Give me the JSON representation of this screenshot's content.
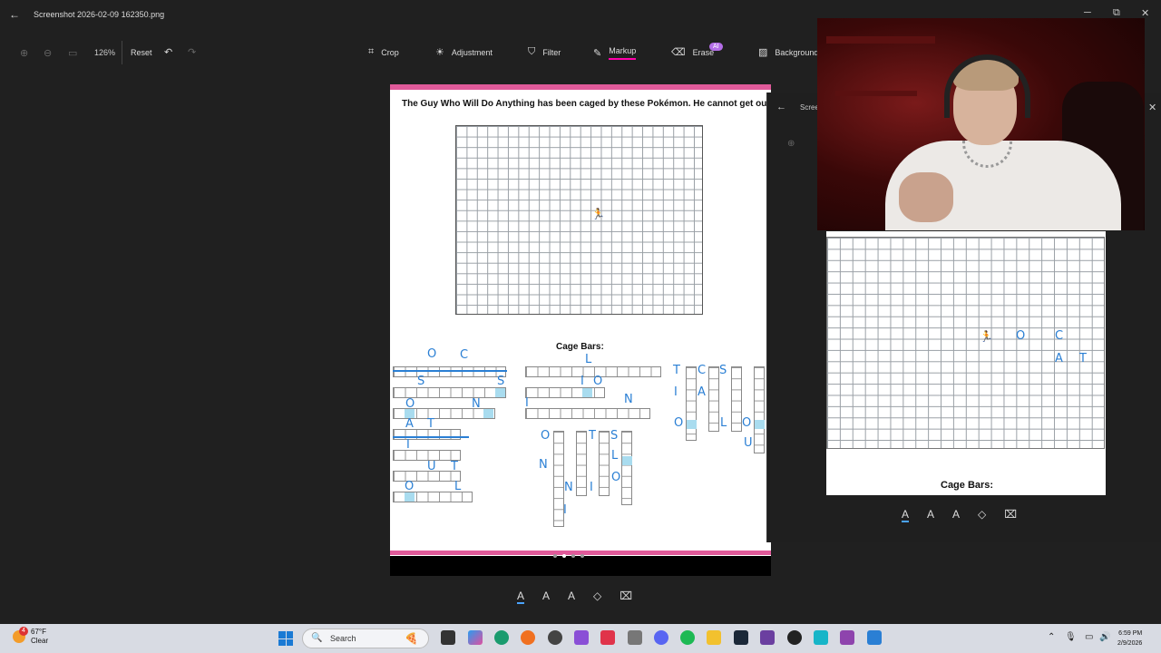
{
  "window": {
    "title": "Screenshot 2026-02-09 162350.png",
    "back": "←",
    "min": "─",
    "max": "⧉",
    "close": "✕"
  },
  "toolbar": {
    "zoom_in": "⊕",
    "zoom_out": "⊖",
    "fit": "▭",
    "zoom": "126%",
    "reset": "Reset",
    "undo": "↶",
    "redo": "↷",
    "tools": [
      {
        "label": "Crop",
        "icon": "⌗"
      },
      {
        "label": "Adjustment",
        "icon": "☀"
      },
      {
        "label": "Filter",
        "icon": "⛉"
      },
      {
        "label": "Markup",
        "icon": "✎"
      },
      {
        "label": "Erase",
        "icon": "⌫"
      },
      {
        "label": "Background",
        "icon": "▨"
      }
    ],
    "ai_badge": "AI"
  },
  "canvas": {
    "title": "The Guy Who Will Do Anything has been caged by these Pokémon. He cannot get out.",
    "runner": "🏃",
    "cage_title": "Cage Bars:",
    "ink": [
      "O",
      "C",
      "S",
      "S",
      "O",
      "N",
      "A",
      "T",
      "I",
      "U",
      "T",
      "O",
      "L",
      "L",
      "I",
      "O",
      "I",
      "N",
      "T",
      "C",
      "S",
      "I",
      "A",
      "O",
      "L",
      "O",
      "U",
      "O",
      "T",
      "S",
      "L",
      "O",
      "N",
      "N",
      "I",
      "I"
    ]
  },
  "side_panel": {
    "title": "Scree",
    "back": "←",
    "close": "✕",
    "zoom_icon": "⊕"
  },
  "preview": {
    "cage_title": "Cage Bars:",
    "runner": "🏃",
    "ink": [
      "O",
      "C",
      "A",
      "T"
    ]
  },
  "markup_tools": [
    "A",
    "A",
    "A",
    "◇",
    "⌧"
  ],
  "taskbar": {
    "weather_temp": "67°F",
    "weather_desc": "Clear",
    "weather_badge": "4",
    "search": "Search",
    "search_icon": "🔍",
    "pizza": "🍕",
    "tray_up": "⌃",
    "tray_mic": "🎙",
    "tray_net": "▭",
    "tray_vol": "🔊",
    "time": "6:59 PM",
    "date": "2/9/2026"
  }
}
